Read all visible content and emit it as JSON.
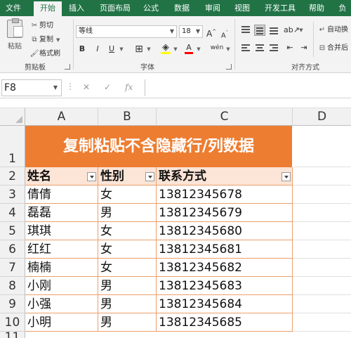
{
  "ribbon_tabs": [
    "文件",
    "开始",
    "插入",
    "页面布局",
    "公式",
    "数据",
    "审阅",
    "视图",
    "开发工具",
    "帮助",
    "负"
  ],
  "clipboard": {
    "paste_label": "粘贴",
    "cut_label": "剪切",
    "copy_label": "复制",
    "format_painter_label": "格式刷",
    "group_label": "剪贴板"
  },
  "font": {
    "font_name": "等线",
    "font_size": "18",
    "bold": "B",
    "italic": "I",
    "underline": "U",
    "grow": "A",
    "shrink": "A",
    "font_color_glyph": "A",
    "phonetic": "wén",
    "group_label": "字体"
  },
  "alignment": {
    "wrap_text_label": "自动换",
    "merge_label": "合并后",
    "group_label": "对齐方式"
  },
  "formula_bar": {
    "name_box": "F8",
    "fx": "fx",
    "cancel": "✕",
    "enter": "✓",
    "content": ""
  },
  "columns": [
    "A",
    "B",
    "C",
    "D"
  ],
  "rows": [
    "1",
    "2",
    "3",
    "4",
    "5",
    "6",
    "7",
    "8",
    "9",
    "10",
    "11"
  ],
  "sheet": {
    "title": "复制粘贴不含隐藏行/列数据",
    "headers": [
      "姓名",
      "性别",
      "联系方式"
    ],
    "records": [
      [
        "倩倩",
        "女",
        "13812345678"
      ],
      [
        "磊磊",
        "男",
        "13812345679"
      ],
      [
        "琪琪",
        "女",
        "13812345680"
      ],
      [
        "红红",
        "女",
        "13812345681"
      ],
      [
        "楠楠",
        "女",
        "13812345682"
      ],
      [
        "小刚",
        "男",
        "13812345683"
      ],
      [
        "小强",
        "男",
        "13812345684"
      ],
      [
        "小明",
        "男",
        "13812345685"
      ]
    ]
  },
  "colors": {
    "ribbon_green": "#217346",
    "title_fill": "#ed7d31",
    "header_fill": "#fce4d6",
    "border_orange": "#ed9f6b"
  }
}
